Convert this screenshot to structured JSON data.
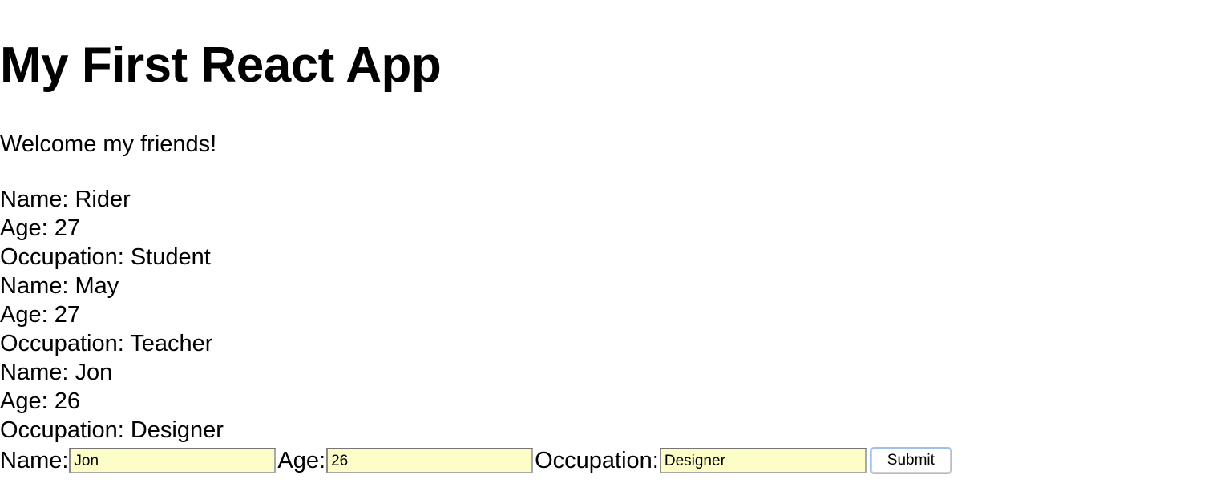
{
  "header": {
    "title": "My First React App"
  },
  "welcome_text": "Welcome my friends!",
  "people": [
    {
      "name_line": "Name: Rider",
      "age_line": "Age: 27",
      "occupation_line": "Occupation: Student"
    },
    {
      "name_line": "Name: May",
      "age_line": "Age: 27",
      "occupation_line": "Occupation: Teacher"
    },
    {
      "name_line": "Name: Jon",
      "age_line": "Age: 26",
      "occupation_line": "Occupation: Designer"
    }
  ],
  "form": {
    "name_label": "Name:",
    "name_value": "Jon",
    "age_label": "Age:",
    "age_value": "26",
    "occupation_label": "Occupation:",
    "occupation_value": "Designer",
    "submit_label": "Submit"
  }
}
